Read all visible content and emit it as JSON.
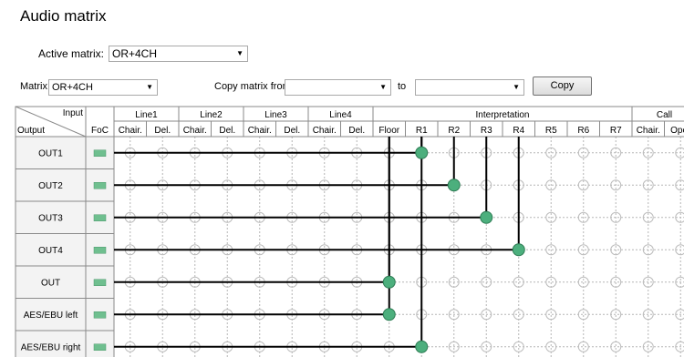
{
  "title": "Audio matrix",
  "active_matrix": {
    "label": "Active matrix:",
    "value": "OR+4CH"
  },
  "toolbar": {
    "matrix_label": "Matrix",
    "matrix_value": "OR+4CH",
    "copy_from_label": "Copy matrix from",
    "copy_from_value": "",
    "to_label": "to",
    "to_value": "",
    "copy_button": "Copy"
  },
  "table": {
    "corner_input": "Input",
    "corner_output": "Output",
    "foc_header": "FoC",
    "groups": [
      "Line1",
      "Line2",
      "Line3",
      "Line4",
      "Interpretation",
      "Call"
    ],
    "columns": [
      "Chair.",
      "Del.",
      "Chair.",
      "Del.",
      "Chair.",
      "Del.",
      "Chair.",
      "Del.",
      "Floor",
      "R1",
      "R2",
      "R3",
      "R4",
      "R5",
      "R6",
      "R7",
      "Chair.",
      "Oper"
    ],
    "rows": [
      "OUT1",
      "OUT2",
      "OUT3",
      "OUT4",
      "OUT",
      "AES/EBU left",
      "AES/EBU right"
    ],
    "connections": [
      {
        "row": "OUT1",
        "column": "R1"
      },
      {
        "row": "OUT2",
        "column": "R2"
      },
      {
        "row": "OUT3",
        "column": "R3"
      },
      {
        "row": "OUT4",
        "column": "R4"
      },
      {
        "row": "OUT",
        "column": "Floor"
      },
      {
        "row": "AES/EBU left",
        "column": "Floor"
      },
      {
        "row": "AES/EBU right",
        "column": "R1"
      }
    ]
  },
  "colors": {
    "connection": "#4caf7d",
    "foc": "#6fbf8f",
    "grid": "#b5b5b5"
  }
}
